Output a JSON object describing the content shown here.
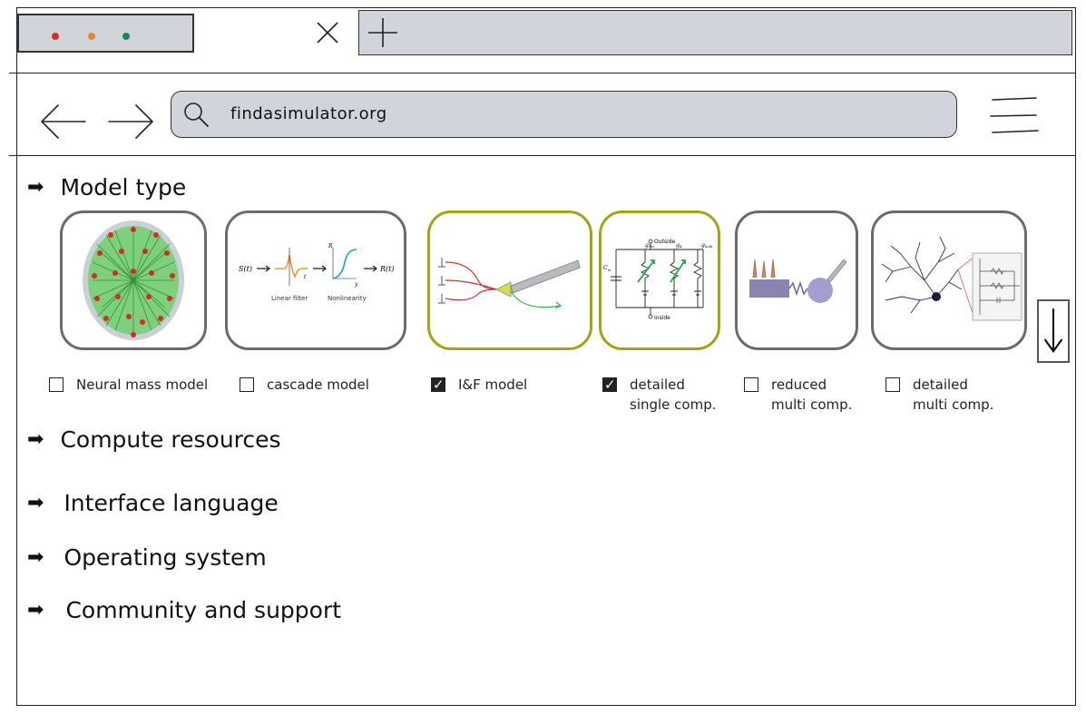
{
  "browser": {
    "url": "findasimulator.org",
    "dot_colors": [
      "#d22f2f",
      "#e8862a",
      "#1a8a5a"
    ]
  },
  "sections": [
    {
      "label": "Model type"
    },
    {
      "label": "Compute resources"
    },
    {
      "label": "Interface language"
    },
    {
      "label": "Operating system"
    },
    {
      "label": "Community and support"
    }
  ],
  "model_types": [
    {
      "label_line1": "Neural mass model",
      "label_line2": "",
      "checked": false
    },
    {
      "label_line1": "cascade model",
      "label_line2": "",
      "checked": false
    },
    {
      "label_line1": "I&F model",
      "label_line2": "",
      "checked": true
    },
    {
      "label_line1": "detailed",
      "label_line2": "single comp.",
      "checked": true
    },
    {
      "label_line1": "reduced",
      "label_line2": "multi comp.",
      "checked": false
    },
    {
      "label_line1": "detailed",
      "label_line2": "multi comp.",
      "checked": false
    }
  ],
  "cascade_diagram": {
    "input": "S(t)",
    "output": "R(t)",
    "linear_filter": "Linear filter",
    "nonlinearity": "Nonlinearity",
    "t_label": "t",
    "r_label": "R",
    "y_label": "y"
  },
  "circuit_diagram": {
    "outside": "Outside",
    "inside": "Inside",
    "cm": "C",
    "cm_sub": "m",
    "gna": "g",
    "gna_sub": "Na",
    "gk": "g",
    "gk_sub": "K",
    "gleak": "g",
    "gleak_sub": "leak"
  },
  "colors": {
    "selected_border": "#a3a313",
    "card_border": "#6b6b6b",
    "chrome_fill": "#d1d5db"
  }
}
